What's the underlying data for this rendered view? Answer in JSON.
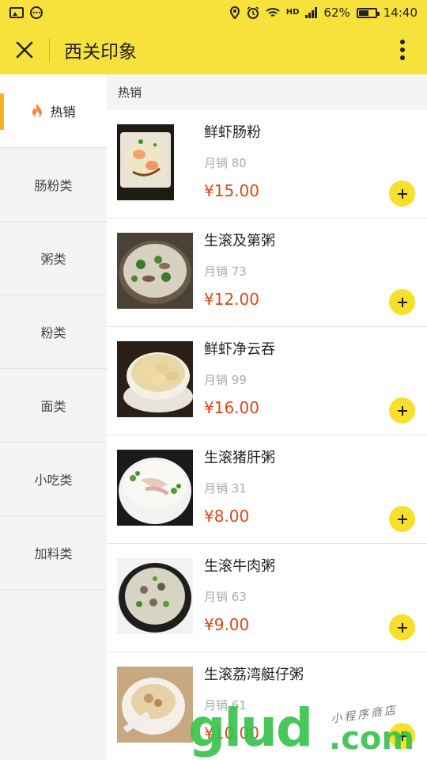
{
  "status_bar": {
    "battery": "62%",
    "battery_level": 0.62,
    "time": "14:40",
    "network": "HD"
  },
  "header": {
    "title": "西关印象"
  },
  "sidebar": {
    "items": [
      {
        "label": "热销",
        "icon": "flame-icon",
        "active": true
      },
      {
        "label": "肠粉类"
      },
      {
        "label": "粥类"
      },
      {
        "label": "粉类"
      },
      {
        "label": "面类"
      },
      {
        "label": "小吃类"
      },
      {
        "label": "加料类"
      }
    ]
  },
  "main": {
    "section_title": "热销",
    "dishes": [
      {
        "name": "鲜虾肠粉",
        "sales": "月销 80",
        "price": "¥15.00"
      },
      {
        "name": "生滚及第粥",
        "sales": "月销 73",
        "price": "¥12.00"
      },
      {
        "name": "鲜虾净云吞",
        "sales": "月销 99",
        "price": "¥16.00"
      },
      {
        "name": "生滚猪肝粥",
        "sales": "月销 31",
        "price": "¥8.00"
      },
      {
        "name": "生滚牛肉粥",
        "sales": "月销 63",
        "price": "¥9.00"
      },
      {
        "name": "生滚荔湾艇仔粥",
        "sales": "月销 61",
        "price": "¥10.00"
      }
    ]
  },
  "watermark": {
    "brand": "glud",
    "domain": ".com",
    "tagline": "小程序商店"
  },
  "colors": {
    "accent": "#f7e23b",
    "price": "#d94a14",
    "add_button": "#f7df2c",
    "active_marker": "#f6b31b"
  }
}
